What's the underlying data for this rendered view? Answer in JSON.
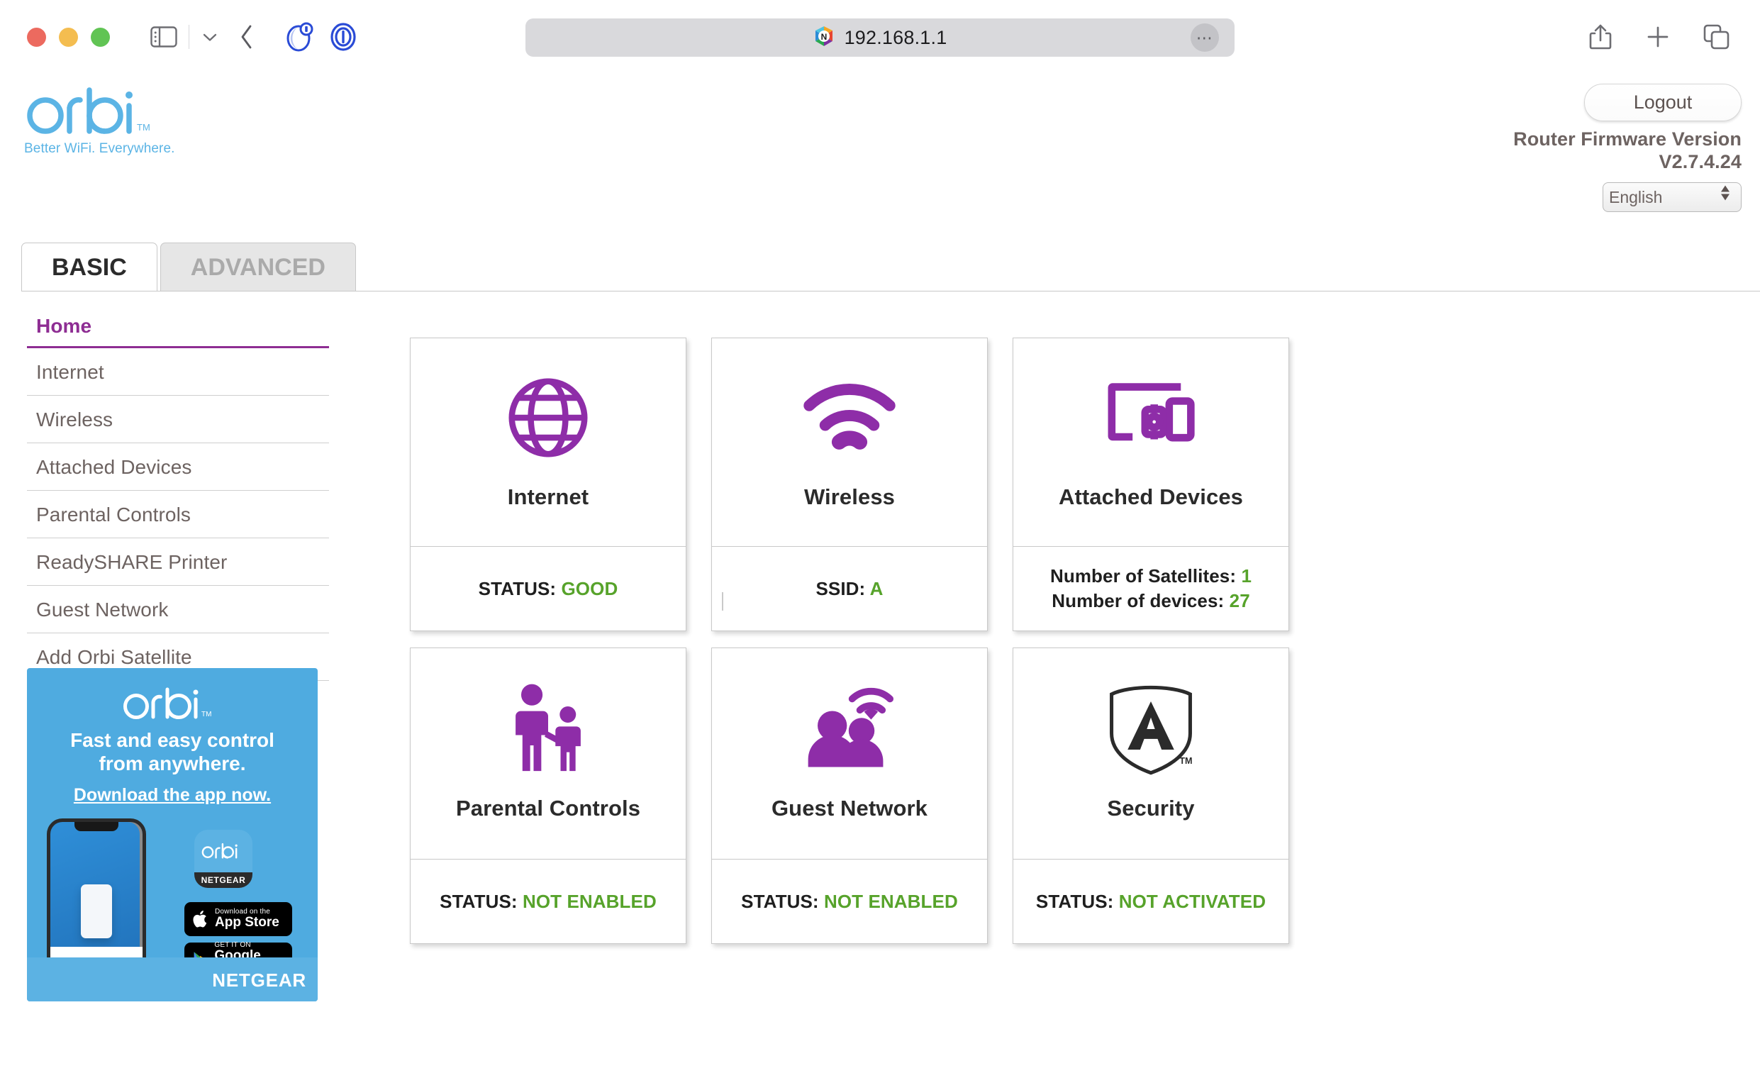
{
  "browser": {
    "window_controls": [
      "close",
      "minimize",
      "maximize"
    ],
    "address": "192.168.1.1",
    "favicon": "netgear-favicon",
    "more_glyph": "⋯",
    "icons": {
      "sidebar": "sidebar-toggle-icon",
      "chevron_down": "chevron-down-icon",
      "back": "back-chevron-icon",
      "extension_1": "nightmode-extension-icon",
      "extension_2": "privacy-extension-icon",
      "share": "share-icon",
      "new_tab": "plus-icon",
      "tabs": "tab-overview-icon"
    }
  },
  "brand": {
    "name": "orbi",
    "trademark": "TM",
    "tagline": "Better WiFi. Everywhere."
  },
  "header": {
    "logout_label": "Logout",
    "firmware_line1": "Router Firmware Version",
    "firmware_line2": "V2.7.4.24",
    "language_selected": "English",
    "language_options": [
      "English"
    ]
  },
  "tabs": [
    {
      "label": "BASIC",
      "active": true
    },
    {
      "label": "ADVANCED",
      "active": false
    }
  ],
  "sidebar": {
    "items": [
      {
        "label": "Home",
        "active": true
      },
      {
        "label": "Internet",
        "active": false
      },
      {
        "label": "Wireless",
        "active": false
      },
      {
        "label": "Attached Devices",
        "active": false
      },
      {
        "label": "Parental Controls",
        "active": false
      },
      {
        "label": "ReadySHARE Printer",
        "active": false
      },
      {
        "label": "Guest Network",
        "active": false
      },
      {
        "label": "Add Orbi Satellite",
        "active": false
      }
    ]
  },
  "promo": {
    "logo": "orbi",
    "trademark": "TM",
    "headline_line1": "Fast and easy control",
    "headline_line2": "from anywhere.",
    "link": "Download the app now.",
    "app_icon_label": "orbi",
    "app_icon_brand": "NETGEAR",
    "appstore_small": "Download on the",
    "appstore_large": "App Store",
    "googleplay_small": "GET IT ON",
    "googleplay_large": "Google Play",
    "brand_footer": "NETGEAR"
  },
  "cards": [
    {
      "id": "internet",
      "title": "Internet",
      "icon": "globe-icon",
      "stats": [
        {
          "label": "STATUS:",
          "value": "GOOD"
        }
      ]
    },
    {
      "id": "wireless",
      "title": "Wireless",
      "icon": "wifi-icon",
      "stats": [
        {
          "label": "SSID:",
          "value": "A"
        }
      ]
    },
    {
      "id": "attached-devices",
      "title": "Attached Devices",
      "icon": "devices-icon",
      "stats": [
        {
          "label": "Number of Satellites:",
          "value": "1"
        },
        {
          "label": "Number of devices:",
          "value": "27"
        }
      ]
    },
    {
      "id": "parental-controls",
      "title": "Parental Controls",
      "icon": "parent-child-icon",
      "stats": [
        {
          "label": "STATUS:",
          "value": "NOT ENABLED"
        }
      ]
    },
    {
      "id": "guest-network",
      "title": "Guest Network",
      "icon": "guest-users-wifi-icon",
      "stats": [
        {
          "label": "STATUS:",
          "value": "NOT ENABLED"
        }
      ]
    },
    {
      "id": "security",
      "title": "Security",
      "icon": "armor-shield-a-icon",
      "stats": [
        {
          "label": "STATUS:",
          "value": "NOT ACTIVATED"
        }
      ]
    }
  ],
  "colors": {
    "accent_purple": "#8e2d93",
    "status_green": "#57a32b",
    "brand_blue": "#5bb4e5",
    "promo_blue": "#4fabe0",
    "nav_text": "#6d6361"
  }
}
